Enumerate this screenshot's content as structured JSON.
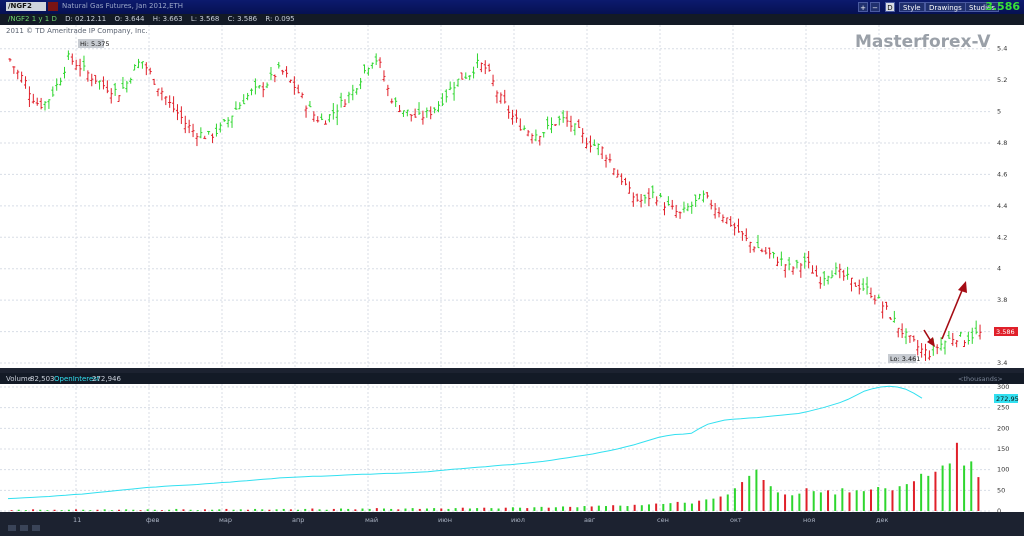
{
  "header": {
    "symbol": "/NGF2",
    "title": "Natural Gas Futures, Jan 2012,ETH",
    "price": "3.586",
    "buttons": [
      "Style",
      "Drawings",
      "Studies"
    ],
    "icon_buttons": [
      "zoom-in-icon",
      "zoom-out-icon",
      "D"
    ]
  },
  "infobar": {
    "sym": "/NGF2 1 y 1 D",
    "date": "D: 02.12.11",
    "open": "O: 3.644",
    "high": "H: 3.663",
    "low": "L: 3.568",
    "close": "C: 3.586",
    "range": "R: 0.095"
  },
  "copyright": "2011 © TD Ameritrade IP Company, Inc.",
  "watermark": "Masterforex-V",
  "hi_label": "Hi: 5.375",
  "lo_label": "Lo: 3.461",
  "current_price_label": "3.586",
  "volume_header": {
    "label": "Volume",
    "value": "82,503",
    "oi_label": "OpenInterest",
    "oi_value": "272,946",
    "units": "<thousands>"
  },
  "oi_marker": "272,95",
  "colors": {
    "up": "#2fd62f",
    "down": "#e0202a",
    "oi_line": "#32e0f0",
    "grid": "#d8dde6",
    "arrow": "#a50c14"
  },
  "chart_data": [
    {
      "type": "bar",
      "subtype": "ohlc",
      "ylim": [
        3.4,
        5.5
      ],
      "y_ticks": [
        3.4,
        3.6,
        3.8,
        4.0,
        4.2,
        4.4,
        4.6,
        4.8,
        5.0,
        5.2,
        5.4
      ],
      "y_tick_labels": [
        "3.4",
        "3.6",
        "3.8",
        "4",
        "4.2",
        "4.4",
        "4.6",
        "4.8",
        "5",
        "5.2",
        "5.4"
      ],
      "x_tick_labels": [
        "11",
        "фев",
        "мар",
        "апр",
        "май",
        "июн",
        "июл",
        "авг",
        "сен",
        "окт",
        "ноя",
        "дек"
      ],
      "close_points": [
        5.33,
        5.25,
        5.2,
        5.1,
        5.04,
        5.06,
        5.13,
        5.22,
        5.34,
        5.31,
        5.27,
        5.23,
        5.2,
        5.16,
        5.14,
        5.12,
        5.18,
        5.27,
        5.33,
        5.26,
        5.18,
        5.12,
        5.04,
        4.99,
        4.93,
        4.88,
        4.86,
        4.84,
        4.86,
        4.9,
        4.95,
        5.02,
        5.07,
        5.12,
        5.14,
        5.17,
        5.22,
        5.27,
        5.22,
        5.16,
        5.09,
        5.02,
        4.96,
        4.94,
        4.98,
        5.03,
        5.08,
        5.13,
        5.21,
        5.29,
        5.35,
        5.27,
        5.11,
        5.04,
        5.01,
        4.98,
        4.96,
        4.98,
        5.01,
        5.06,
        5.12,
        5.18,
        5.22,
        5.24,
        5.3,
        5.29,
        5.21,
        5.1,
        5.03,
        4.96,
        4.91,
        4.88,
        4.86,
        4.87,
        4.9,
        4.94,
        4.95,
        4.91,
        4.87,
        4.82,
        4.79,
        4.77,
        4.71,
        4.63,
        4.56,
        4.48,
        4.44,
        4.43,
        4.48,
        4.45,
        4.4,
        4.37,
        4.34,
        4.39,
        4.42,
        4.46,
        4.42,
        4.38,
        4.33,
        4.28,
        4.23,
        4.18,
        4.15,
        4.12,
        4.09,
        4.07,
        4.04,
        4.0,
        4.02,
        4.05,
        3.99,
        3.93,
        3.97,
        3.99,
        3.96,
        3.93,
        3.9,
        3.88,
        3.85,
        3.8,
        3.75,
        3.68,
        3.62,
        3.56,
        3.52,
        3.48,
        3.46,
        3.5,
        3.53,
        3.56,
        3.57,
        3.55,
        3.58,
        3.586
      ],
      "open": 3.644,
      "high_value": 5.375,
      "low_value": 3.461
    },
    {
      "type": "bar",
      "subtype": "volume",
      "ylim": [
        0,
        300
      ],
      "y_ticks": [
        0,
        50,
        100,
        150,
        200,
        250,
        300
      ],
      "y_tick_labels": [
        "0",
        "50",
        "100",
        "150",
        "200",
        "250",
        "300"
      ],
      "values": [
        2,
        3,
        2,
        4,
        3,
        2,
        3,
        2,
        3,
        4,
        3,
        2,
        3,
        4,
        2,
        3,
        4,
        3,
        2,
        4,
        3,
        2,
        3,
        5,
        4,
        3,
        2,
        4,
        3,
        4,
        5,
        3,
        4,
        3,
        5,
        4,
        3,
        4,
        5,
        4,
        3,
        5,
        6,
        4,
        3,
        5,
        6,
        5,
        4,
        6,
        5,
        7,
        6,
        5,
        4,
        6,
        7,
        5,
        6,
        7,
        6,
        5,
        7,
        8,
        6,
        7,
        8,
        7,
        6,
        8,
        9,
        8,
        7,
        9,
        10,
        8,
        9,
        11,
        10,
        9,
        12,
        11,
        13,
        12,
        14,
        13,
        12,
        15,
        14,
        16,
        18,
        17,
        19,
        22,
        20,
        18,
        25,
        28,
        30,
        35,
        40,
        55,
        70,
        85,
        100,
        75,
        60,
        45,
        40,
        38,
        42,
        55,
        48,
        45,
        50,
        40,
        55,
        45,
        50,
        48,
        52,
        58,
        55,
        50,
        60,
        65,
        72,
        90,
        85,
        95,
        110,
        115,
        165,
        110,
        120,
        82
      ],
      "open_interest": {
        "name": "OpenInterest",
        "values": [
          30,
          31,
          32,
          33,
          34,
          35,
          37,
          38,
          40,
          41,
          43,
          45,
          47,
          49,
          51,
          53,
          55,
          57,
          58,
          60,
          61,
          62,
          63,
          64,
          66,
          67,
          69,
          70,
          72,
          73,
          75,
          77,
          78,
          80,
          81,
          82,
          83,
          84,
          84,
          85,
          86,
          87,
          88,
          89,
          89,
          90,
          91,
          91,
          92,
          93,
          94,
          95,
          97,
          99,
          101,
          102,
          104,
          106,
          107,
          109,
          111,
          112,
          114,
          116,
          118,
          120,
          123,
          126,
          129,
          132,
          135,
          138,
          142,
          146,
          150,
          155,
          160,
          166,
          172,
          178,
          182,
          185,
          186,
          188,
          200,
          210,
          215,
          220,
          222,
          223,
          225,
          226,
          228,
          230,
          232,
          234,
          236,
          240,
          245,
          250,
          256,
          262,
          270,
          280,
          290,
          296,
          300,
          302,
          300,
          295,
          285,
          273
        ]
      }
    }
  ]
}
